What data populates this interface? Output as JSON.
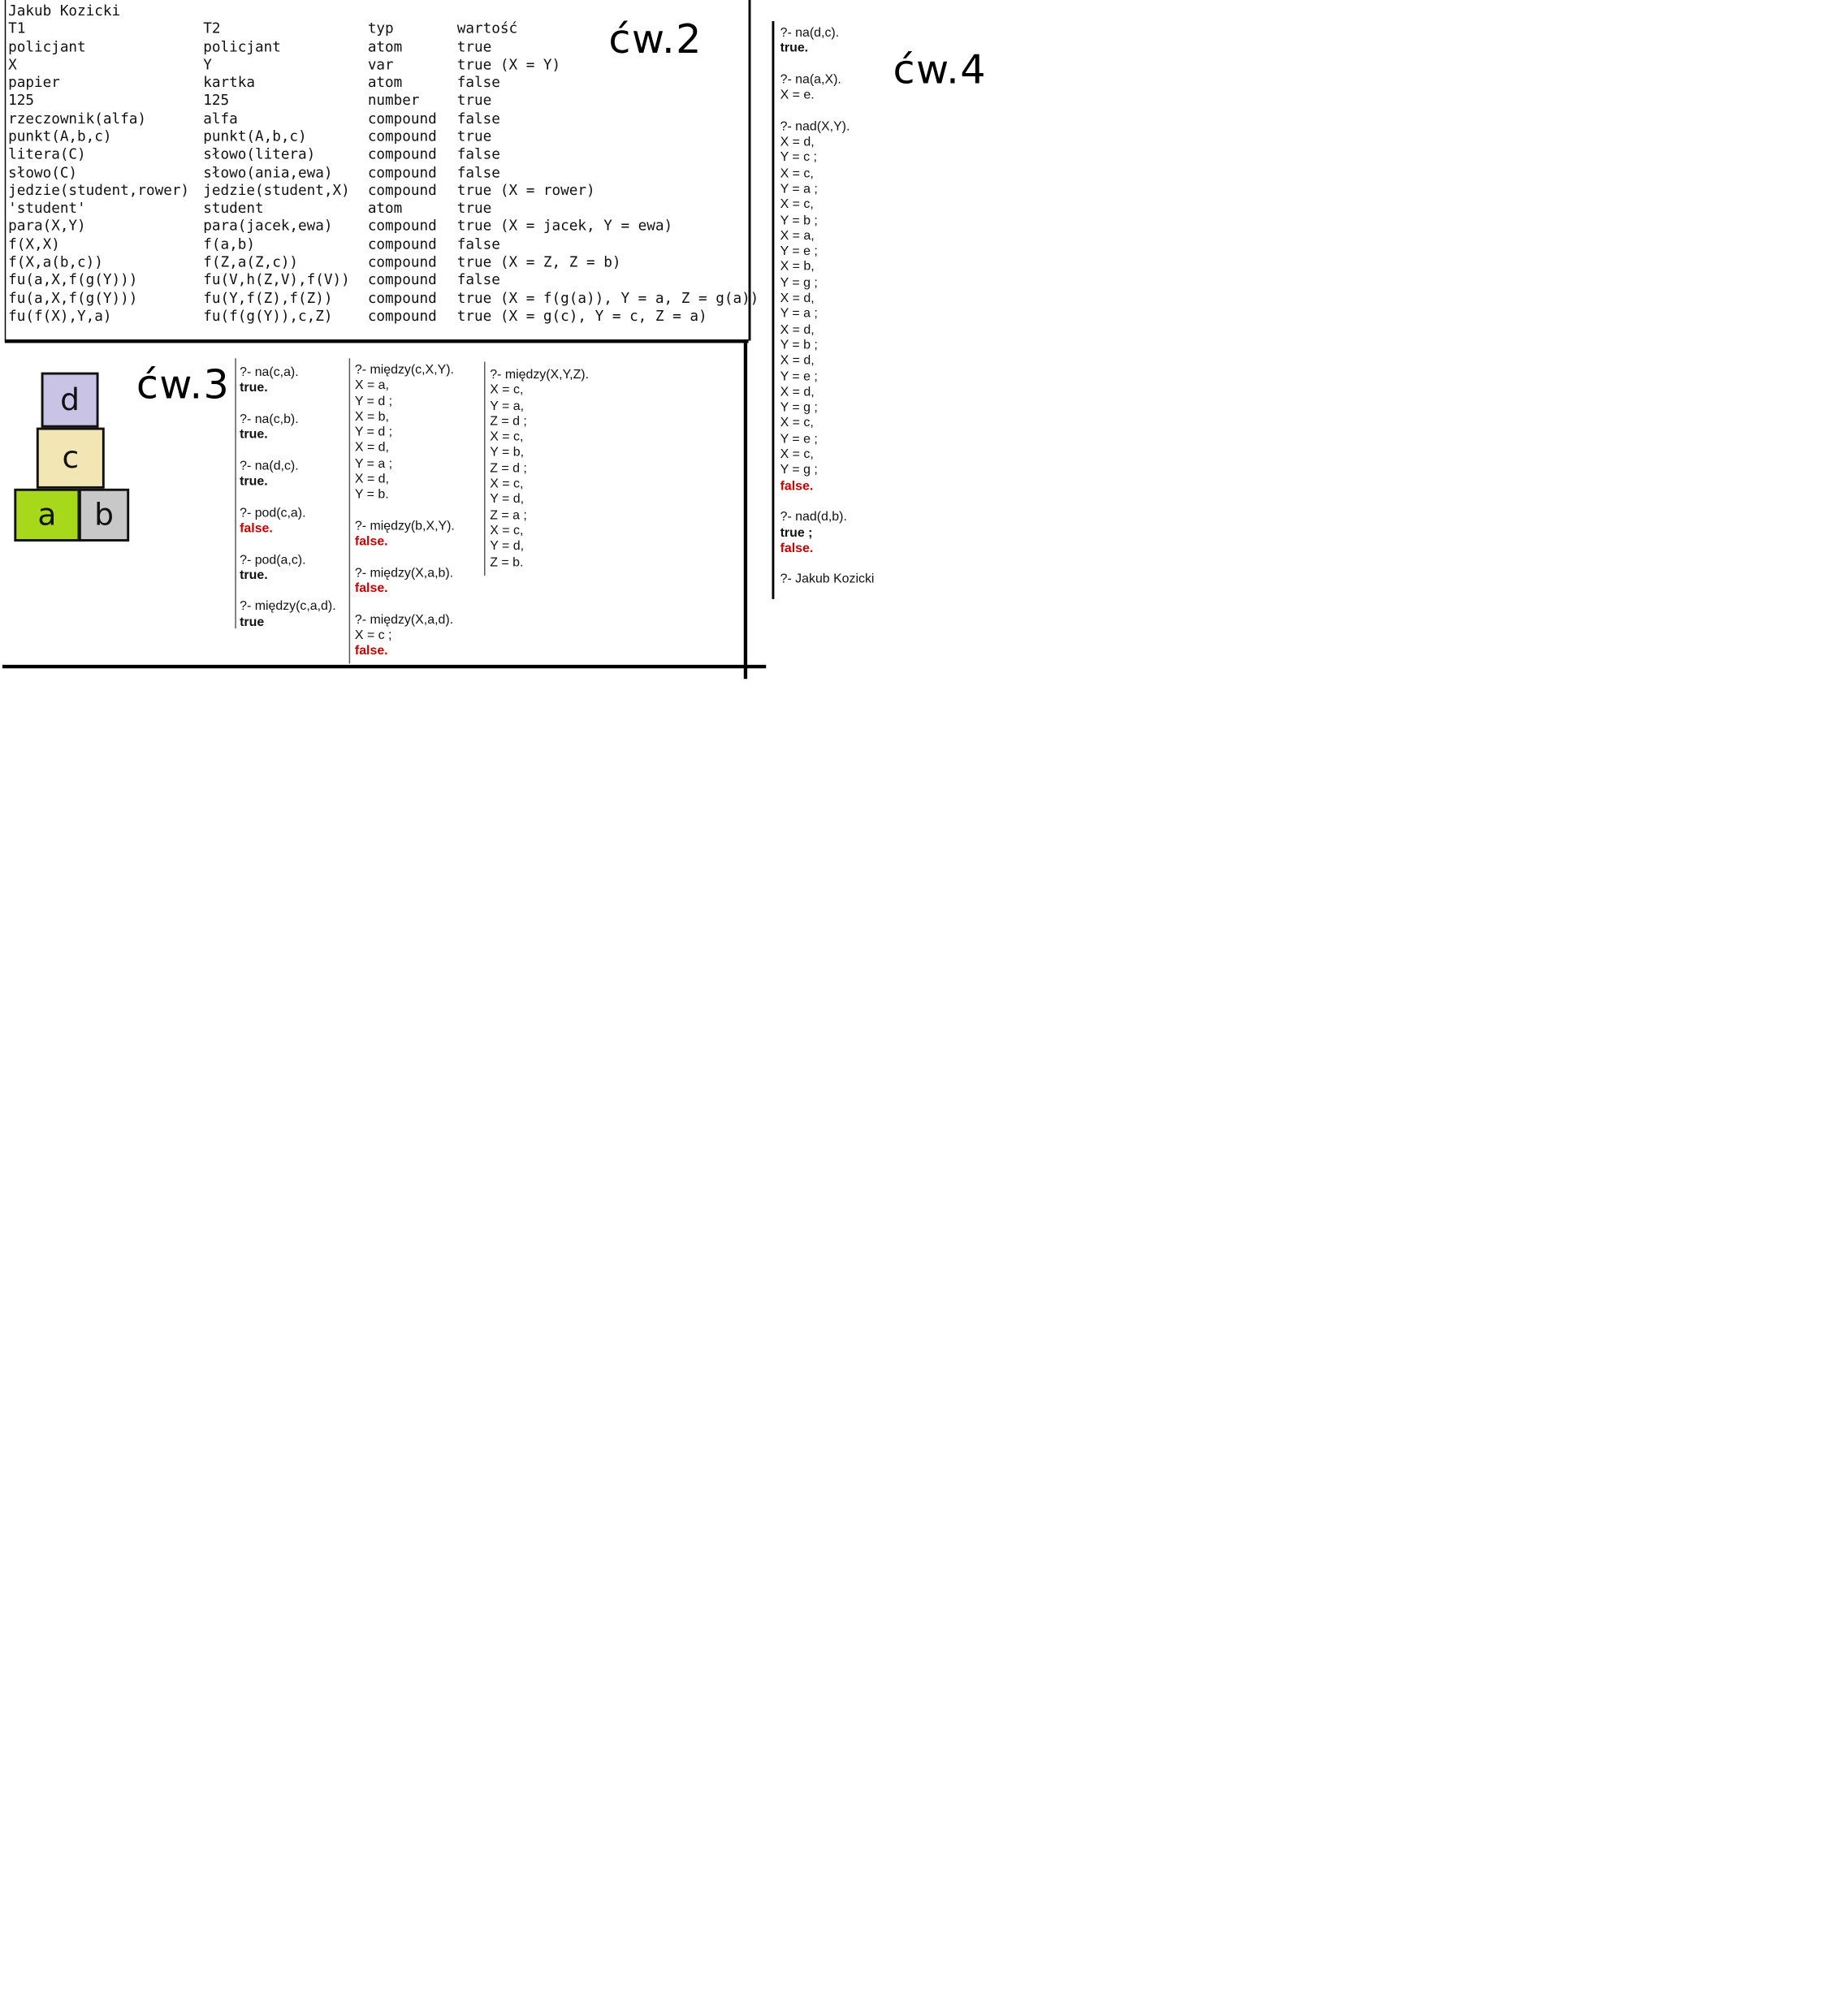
{
  "author_header": "Jakub Kozicki",
  "table": {
    "headers": [
      "T1",
      "T2",
      "typ",
      "wartość"
    ],
    "rows": [
      [
        "policjant",
        "policjant",
        "atom",
        "true"
      ],
      [
        "X",
        "Y",
        "var",
        "true (X = Y)"
      ],
      [
        "papier",
        "kartka",
        "atom",
        "false"
      ],
      [
        "125",
        "125",
        "number",
        "true"
      ],
      [
        "rzeczownik(alfa)",
        "alfa",
        "compound",
        "false"
      ],
      [
        "punkt(A,b,c)",
        "punkt(A,b,c)",
        "compound",
        "true"
      ],
      [
        "litera(C)",
        "słowo(litera)",
        "compound",
        "false"
      ],
      [
        "słowo(C)",
        "słowo(ania,ewa)",
        "compound",
        "false"
      ],
      [
        "jedzie(student,rower)",
        "jedzie(student,X)",
        "compound",
        "true (X = rower)"
      ],
      [
        "'student'",
        "student",
        "atom",
        "true"
      ],
      [
        "para(X,Y)",
        "para(jacek,ewa)",
        "compound",
        "true (X = jacek, Y = ewa)"
      ],
      [
        "f(X,X)",
        "f(a,b)",
        "compound",
        "false"
      ],
      [
        "f(X,a(b,c))",
        "f(Z,a(Z,c))",
        "compound",
        "true (X = Z, Z = b)"
      ],
      [
        "fu(a,X,f(g(Y)))",
        "fu(V,h(Z,V),f(V))",
        "compound",
        "false"
      ],
      [
        "fu(a,X,f(g(Y)))",
        "fu(Y,f(Z),f(Z))",
        "compound",
        "true (X = f(g(a)), Y = a, Z = g(a))"
      ],
      [
        "fu(f(X),Y,a)",
        "fu(f(g(Y)),c,Z)",
        "compound",
        "true (X = g(c), Y = c, Z = a)"
      ]
    ]
  },
  "labels": {
    "cw2": "ćw.2",
    "cw3": "ćw.3",
    "cw4": "ćw.4"
  },
  "blocks": {
    "d": "d",
    "c": "c",
    "a": "a",
    "b": "b"
  },
  "blocks_colors": {
    "d": "#c9c3e6",
    "c": "#f1e6b4",
    "a": "#a8d81a",
    "b": "#c8c8c8"
  },
  "cw3": {
    "col1": [
      {
        "q": "?- na(c,a).",
        "a": [
          "true."
        ]
      },
      {
        "q": "?- na(c,b).",
        "a": [
          "true."
        ]
      },
      {
        "q": "?- na(d,c).",
        "a": [
          "true."
        ]
      },
      {
        "q": "?- pod(c,a).",
        "a": [
          "false."
        ]
      },
      {
        "q": "?- pod(a,c).",
        "a": [
          "true."
        ]
      },
      {
        "q": "?- między(c,a,d).",
        "a": [
          "true"
        ]
      }
    ],
    "col2": {
      "q1": "?- między(c,X,Y).",
      "q1_lines": [
        "X = a,",
        "Y = d ;",
        "X = b,",
        "Y = d ;",
        "X = d,",
        "Y = a ;",
        "X = d,",
        "Y = b."
      ],
      "q2": "?- między(b,X,Y).",
      "q2_ans": "false.",
      "q3": "?- między(X,a,b).",
      "q3_ans": "false.",
      "q4": "?- między(X,a,d).",
      "q4_line": "X = c ;",
      "q4_ans": "false."
    },
    "col3": {
      "q": "?- między(X,Y,Z).",
      "lines": [
        "X = c,",
        "Y = a,",
        "Z = d ;",
        "X = c,",
        "Y = b,",
        "Z = d ;",
        "X = c,",
        "Y = d,",
        "Z = a ;",
        "X = c,",
        "Y = d,",
        "Z = b."
      ]
    }
  },
  "cw4": {
    "q1": "?- na(d,c).",
    "a1": "true.",
    "q2": "?- na(a,X).",
    "a2": "X = e.",
    "q3": "?- nad(X,Y).",
    "q3_lines": [
      "X = d,",
      "Y = c ;",
      "X = c,",
      "Y = a ;",
      "X = c,",
      "Y = b ;",
      "X = a,",
      "Y = e ;",
      "X = b,",
      "Y = g ;",
      "X = d,",
      "Y = a ;",
      "X = d,",
      "Y = b ;",
      "X = d,",
      "Y = e ;",
      "X = d,",
      "Y = g ;",
      "X = c,",
      "Y = e ;",
      "X = c,",
      "Y = g ;"
    ],
    "q3_ans": "false.",
    "q4": "?- nad(d,b).",
    "q4_a": "true ;",
    "q4_b": "false.",
    "q5": "?- Jakub Kozicki"
  }
}
